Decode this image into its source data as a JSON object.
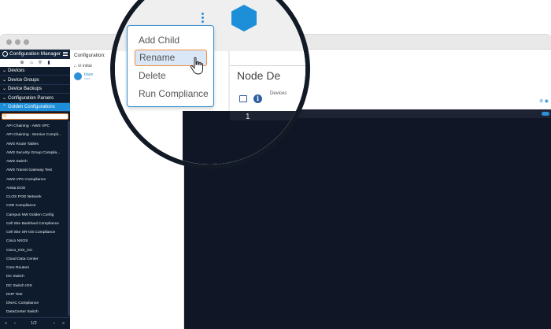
{
  "app": {
    "title": "Configuration Manager"
  },
  "sidebar": {
    "groups": [
      {
        "label": "Devices",
        "expanded": false
      },
      {
        "label": "Device Groups",
        "expanded": false
      },
      {
        "label": "Device Backups",
        "expanded": false
      },
      {
        "label": "Configuration Parsers",
        "expanded": false
      },
      {
        "label": "Golden Configurations",
        "expanded": true
      }
    ],
    "search": {
      "value": "",
      "placeholder": ""
    },
    "items": [
      "API Chaining - AWS VPC",
      "API Chaining - Service Compli...",
      "AWS Route Tables",
      "AWS Security Group Complia...",
      "AWS Switch",
      "AWS Transit Gateway Test",
      "AWS-VPC-Compliance",
      "Arista EOS",
      "CLOS POD Network",
      "CSR Compliance",
      "Campus NW Golden Config",
      "Cell Site Backhaul Compliance",
      "Cell Site SR-OS Compliance",
      "Cisco NXOS",
      "Cisco_IOS_GC",
      "Cloud Data Center",
      "Core Routers",
      "DC Switch",
      "DC Switch IOS",
      "DHP Test",
      "DNAC Compliance",
      "DataCenter Switch"
    ],
    "pagination": {
      "page": "1/2"
    }
  },
  "tree": {
    "title": "Configuration:",
    "root_label": "initial",
    "node_label": "base",
    "node_sub": "base"
  },
  "editor": {
    "title": "Node De",
    "tab_label": "Devices",
    "line_numbers": [
      "1"
    ]
  },
  "context_menu": {
    "items": [
      {
        "label": "Add Child",
        "highlighted": false
      },
      {
        "label": "Rename",
        "highlighted": true
      },
      {
        "label": "Delete",
        "highlighted": false
      },
      {
        "label": "Run Compliance",
        "highlighted": false
      }
    ]
  },
  "colors": {
    "sidebar_bg": "#0e1b2c",
    "accent": "#1d8ed8",
    "highlight_border": "#f08c3a",
    "code_bg": "#111627"
  }
}
